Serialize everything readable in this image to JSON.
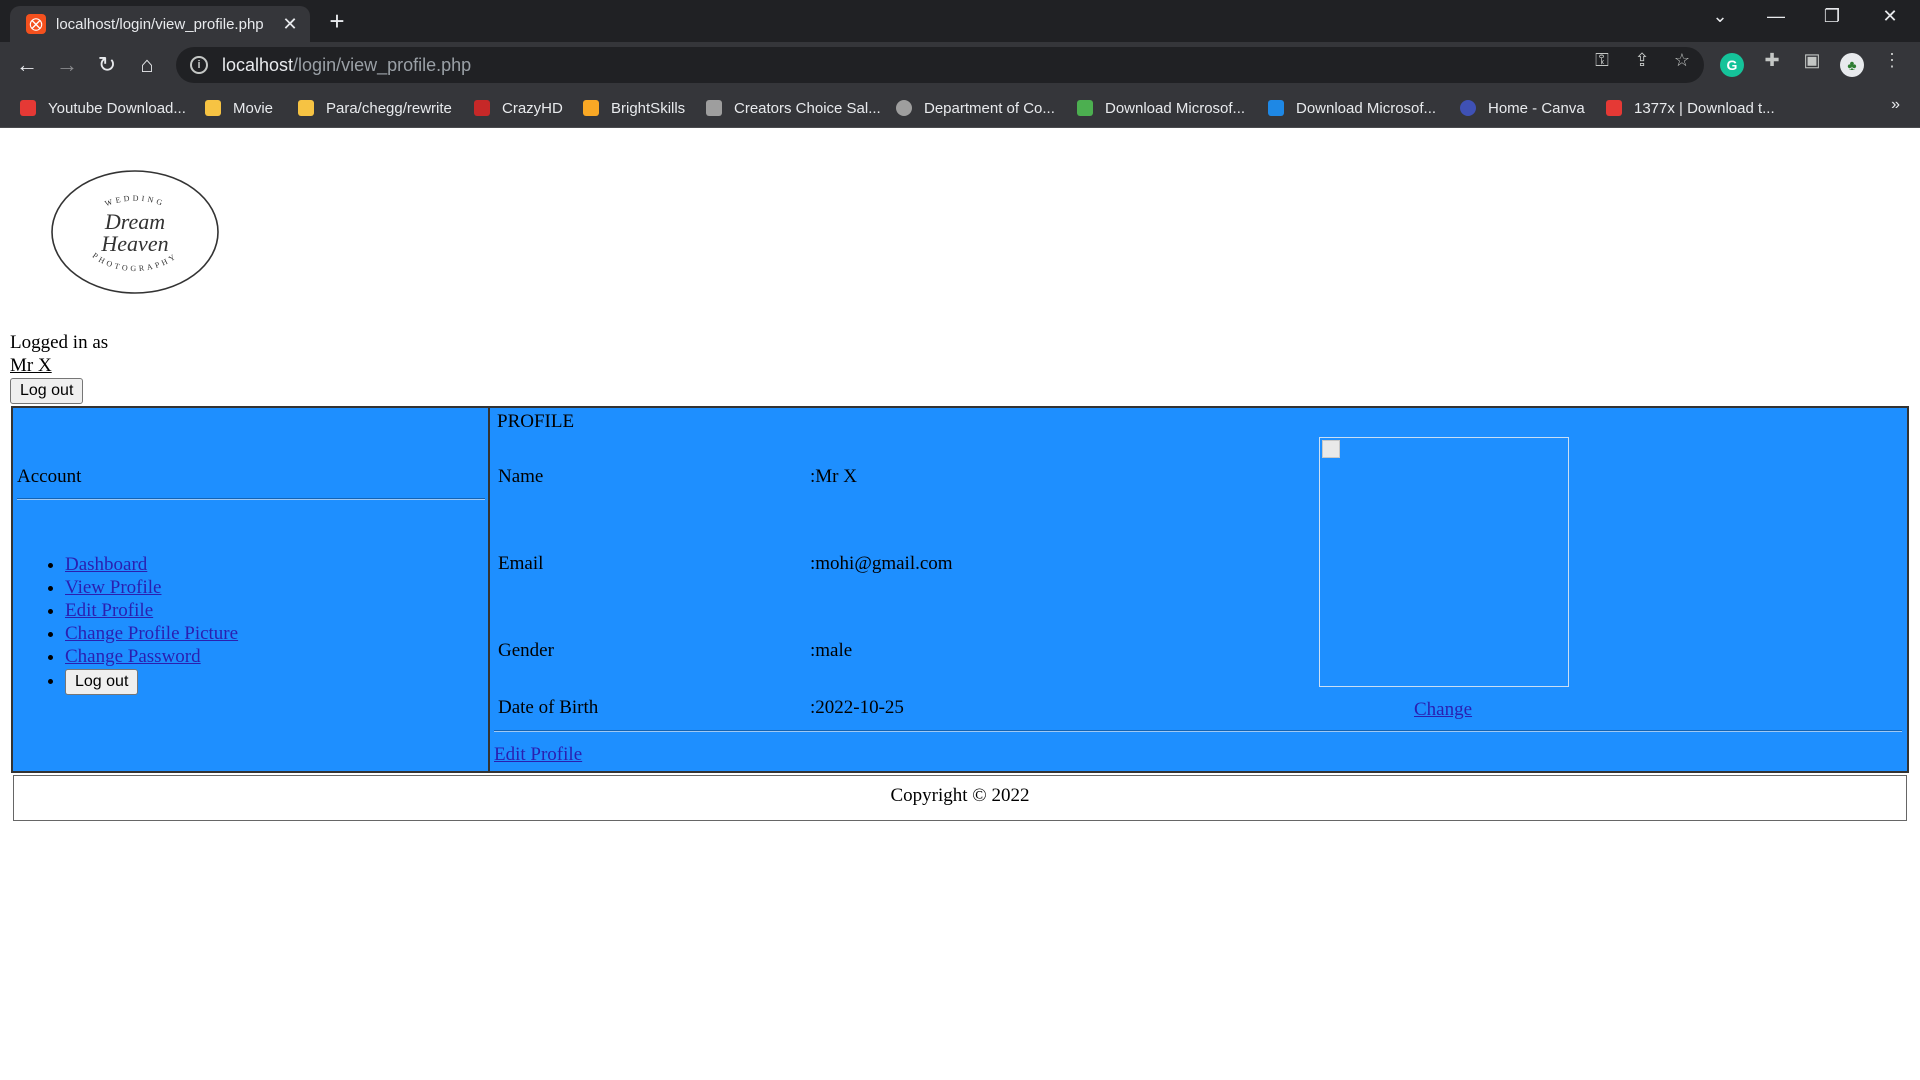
{
  "browser": {
    "tab_title": "localhost/login/view_profile.php",
    "url_host": "localhost",
    "url_path": "/login/view_profile.php",
    "bookmarks": [
      {
        "label": "Youtube Download...",
        "color": "#e53935"
      },
      {
        "label": "Movie",
        "color": "#f6c343"
      },
      {
        "label": "Para/chegg/rewrite",
        "color": "#f6c343"
      },
      {
        "label": "CrazyHD",
        "color": "#c62828"
      },
      {
        "label": "BrightSkills",
        "color": "#f9a825"
      },
      {
        "label": "Creators Choice Sal...",
        "color": "#9e9e9e"
      },
      {
        "label": "Department of Co...",
        "color": "#9e9e9e"
      },
      {
        "label": "Download Microsof...",
        "color": "#4caf50"
      },
      {
        "label": "Download Microsof...",
        "color": "#1e88e5"
      },
      {
        "label": "Home - Canva",
        "color": "#3f51b5"
      },
      {
        "label": "1377x | Download t...",
        "color": "#e53935"
      }
    ],
    "more_label": "»",
    "icons": {
      "back": "back-arrow-icon",
      "forward": "forward-arrow-icon",
      "reload": "reload-icon",
      "home": "home-icon",
      "key": "key-icon",
      "share": "share-icon",
      "star": "star-icon",
      "grammarly": "grammarly-icon",
      "extensions": "puzzle-icon",
      "sidepanel": "side-panel-icon",
      "profile": "profile-avatar-icon",
      "menu": "kebab-menu-icon"
    }
  },
  "header": {
    "logo_text": {
      "top": "WEDDING",
      "script1": "Dream",
      "script2": "Heaven",
      "bottom": "PHOTOGRAPHY"
    },
    "logged_in_label": "Logged in as",
    "username": "Mr X",
    "logout_label": "Log out"
  },
  "sidebar": {
    "title": "Account",
    "links": [
      "Dashboard",
      "View Profile",
      "Edit Profile",
      "Change Profile Picture",
      "Change Password"
    ],
    "logout_label": "Log out"
  },
  "profile": {
    "heading": "PROFILE",
    "fields": [
      {
        "label": "Name",
        "value": ":Mr X"
      },
      {
        "label": "Email",
        "value": ":mohi@gmail.com"
      },
      {
        "label": "Gender",
        "value": ":male"
      },
      {
        "label": "Date of Birth",
        "value": ":2022-10-25"
      }
    ],
    "change_label": "Change",
    "edit_label": "Edit Profile"
  },
  "footer": {
    "copyright": "Copyright © 2022"
  },
  "colors": {
    "content_bg": "#1e8fff",
    "link": "#2a1fb0"
  }
}
